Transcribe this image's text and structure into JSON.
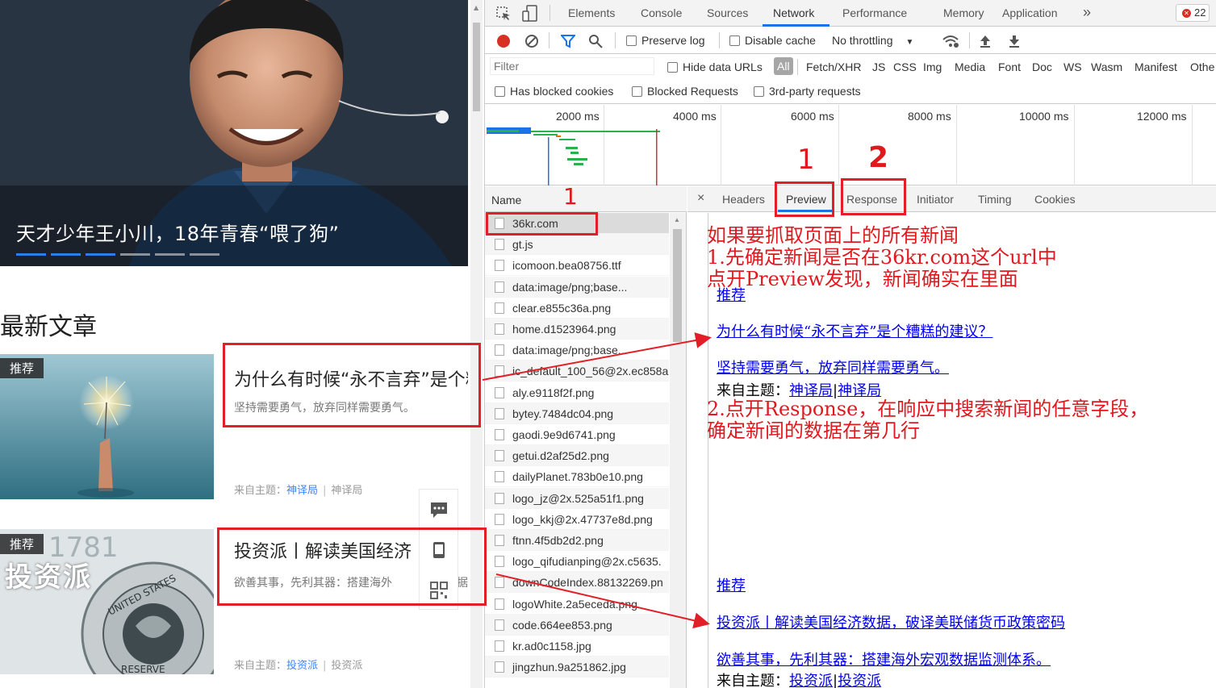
{
  "site": {
    "hero": {
      "title": "天才少年王小川，18年青春“喂了狗”",
      "dots": [
        true,
        true,
        true,
        false,
        false,
        false
      ]
    },
    "latest_heading": "最新文章",
    "articles": [
      {
        "tag": "推荐",
        "title": "为什么有时候“永不言弃”是个糟",
        "summary": "坚持需要勇气，放弃同样需要勇气。",
        "meta_prefix": "来自主题：",
        "topic_link": "神译局",
        "topic_plain": "神译局"
      },
      {
        "tag": "推荐",
        "title": "投资派丨解读美国经济",
        "summary": "欲善其事，先利其器：搭建海外",
        "summary_tail": "据",
        "meta_prefix": "来自主题：",
        "topic_link": "投资派",
        "topic_plain": "投资派",
        "thumb_text": "投资派"
      }
    ],
    "float_icons": [
      "comment-icon",
      "mobile-icon",
      "qrcode-icon"
    ]
  },
  "devtools": {
    "tabs": [
      "Elements",
      "Console",
      "Sources",
      "Network",
      "Performance",
      "Memory",
      "Application"
    ],
    "active_tab": "Network",
    "more_tabs": "»",
    "error_count": "22",
    "toolbar": {
      "preserve_log": "Preserve log",
      "disable_cache": "Disable cache",
      "throttling": "No throttling"
    },
    "filter": {
      "placeholder": "Filter",
      "hide_data_urls": "Hide data URLs",
      "types": [
        "All",
        "Fetch/XHR",
        "JS",
        "CSS",
        "Img",
        "Media",
        "Font",
        "Doc",
        "WS",
        "Wasm",
        "Manifest",
        "Othe"
      ],
      "has_blocked_cookies": "Has blocked cookies",
      "blocked_requests": "Blocked Requests",
      "third_party": "3rd-party requests"
    },
    "timeline_labels": [
      "2000 ms",
      "4000 ms",
      "6000 ms",
      "8000 ms",
      "10000 ms",
      "12000 ms"
    ],
    "name_header": "Name",
    "requests": [
      "36kr.com",
      "gt.js",
      "icomoon.bea08756.ttf",
      "data:image/png;base...",
      "clear.e855c36a.png",
      "home.d1523964.png",
      "data:image/png;base...",
      "ic_default_100_56@2x.ec858a",
      "aly.e9118f2f.png",
      "bytey.7484dc04.png",
      "gaodi.9e9d6741.png",
      "getui.d2af25d2.png",
      "dailyPlanet.783b0e10.png",
      "logo_jz@2x.525a51f1.png",
      "logo_kkj@2x.47737e8d.png",
      "ftnn.4f5db2d2.png",
      "logo_qifudianping@2x.c5635.",
      "downCodeIndex.88132269.pn",
      "logoWhite.2a5eceda.png",
      "code.664ee853.png",
      "kr.ad0c1158.jpg",
      "jingzhun.9a251862.jpg"
    ],
    "detail_tabs": [
      "Headers",
      "Preview",
      "Response",
      "Initiator",
      "Timing",
      "Cookies"
    ],
    "close_symbol": "×",
    "preview": {
      "block1": {
        "tag": "推荐",
        "title": "为什么有时候“永不言弃”是个糟糕的建议？",
        "summary": "坚持需要勇气，放弃同样需要勇气。",
        "meta_prefix": "来自主题：",
        "topic_a": "神译局",
        "topic_b": "神译局"
      },
      "block2": {
        "tag": "推荐",
        "title": "投资派丨解读美国经济数据，破译美联储货币政策密码",
        "summary": "欲善其事，先利其器：搭建海外宏观数据监测体系。",
        "meta_prefix": "来自主题：",
        "topic_a": "投资派",
        "topic_b": "投资派"
      }
    }
  },
  "annotations": {
    "marks": [
      "1",
      "2",
      "1"
    ],
    "note_lines": [
      "如果要抓取页面上的所有新闻",
      "1.先确定新闻是否在36kr.com这个url中",
      "点开Preview发现，新闻确实在里面"
    ],
    "note2_lines": [
      "2.点开Response，在响应中搜索新闻的任意字段，",
      "确定新闻的数据在第几行"
    ],
    "color": "#e21f26"
  }
}
